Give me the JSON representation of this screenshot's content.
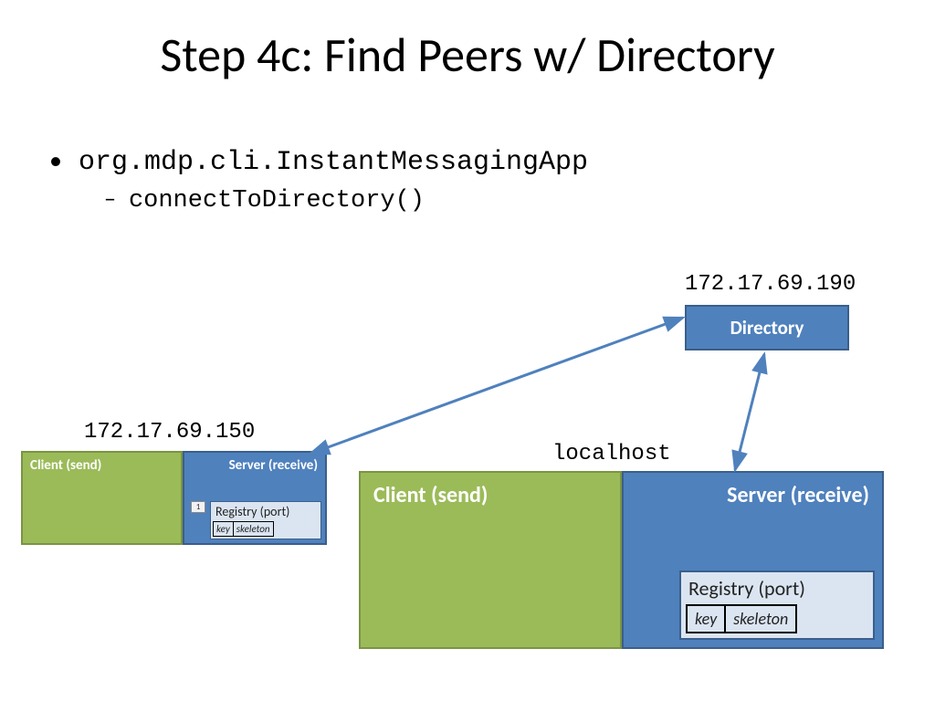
{
  "title": "Step 4c: Find Peers w/ Directory",
  "bullet": {
    "main": "org.mdp.cli.InstantMessagingApp",
    "sub": "connectToDirectory()"
  },
  "ips": {
    "directory": "172.17.69.190",
    "small": "172.17.69.150",
    "big": "localhost"
  },
  "labels": {
    "directory": "Directory",
    "client": "Client (send)",
    "server": "Server (receive)",
    "registry": "Registry (port)",
    "key": "key",
    "skeleton": "skeleton",
    "badge": "1"
  }
}
